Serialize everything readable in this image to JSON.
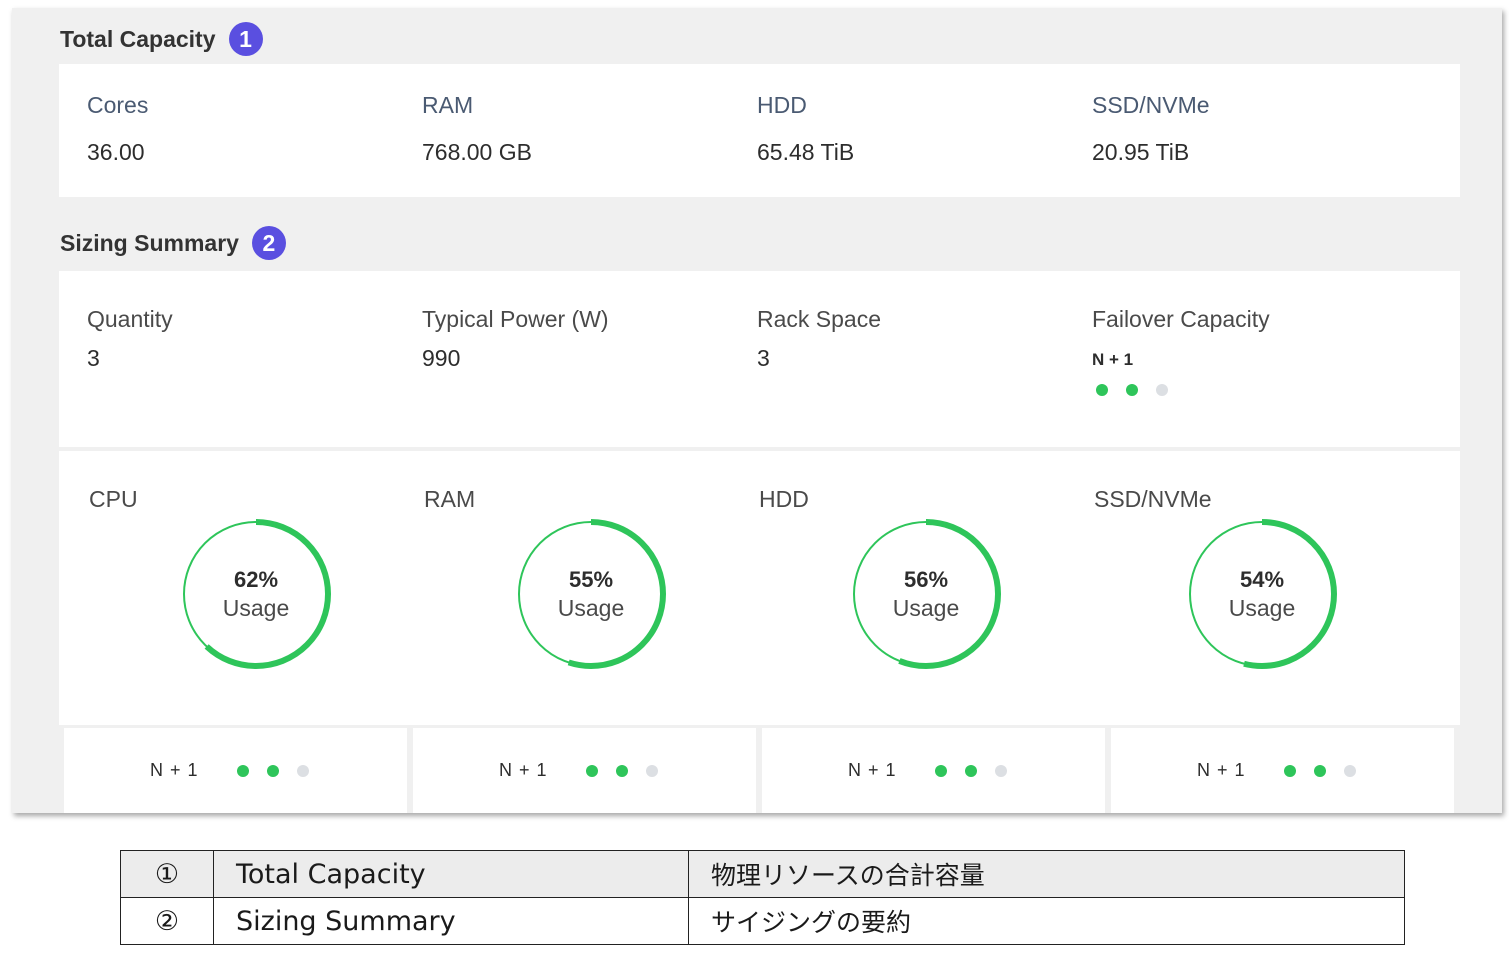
{
  "total_capacity": {
    "title": "Total Capacity",
    "badge": "1",
    "items": [
      {
        "label": "Cores",
        "value": "36.00"
      },
      {
        "label": "RAM",
        "value": "768.00 GB"
      },
      {
        "label": "HDD",
        "value": "65.48 TiB"
      },
      {
        "label": "SSD/NVMe",
        "value": "20.95 TiB"
      }
    ]
  },
  "sizing_summary": {
    "title": "Sizing Summary",
    "badge": "2",
    "stats": [
      {
        "label": "Quantity",
        "value": "3"
      },
      {
        "label": "Typical Power (W)",
        "value": "990"
      },
      {
        "label": "Rack Space",
        "value": "3"
      },
      {
        "label": "Failover Capacity",
        "value": "N + 1",
        "dots_active": 2,
        "dots_total": 3
      }
    ],
    "usage": [
      {
        "label": "CPU",
        "percent": 62,
        "percent_text": "62%",
        "usage_text": "Usage",
        "footer": "N + 1",
        "dots_active": 2,
        "dots_total": 3
      },
      {
        "label": "RAM",
        "percent": 55,
        "percent_text": "55%",
        "usage_text": "Usage",
        "footer": "N + 1",
        "dots_active": 2,
        "dots_total": 3
      },
      {
        "label": "HDD",
        "percent": 56,
        "percent_text": "56%",
        "usage_text": "Usage",
        "footer": "N + 1",
        "dots_active": 2,
        "dots_total": 3
      },
      {
        "label": "SSD/NVMe",
        "percent": 54,
        "percent_text": "54%",
        "usage_text": "Usage",
        "footer": "N + 1",
        "dots_active": 2,
        "dots_total": 3
      }
    ]
  },
  "legend": [
    {
      "num": "①",
      "name": "Total Capacity",
      "desc": "物理リソースの合計容量"
    },
    {
      "num": "②",
      "name": "Sizing Summary",
      "desc": "サイジングの要約"
    }
  ],
  "colors": {
    "accent_badge": "#5a4fe0",
    "gauge_green": "#2ec55a",
    "dot_off": "#dcdfe3"
  }
}
